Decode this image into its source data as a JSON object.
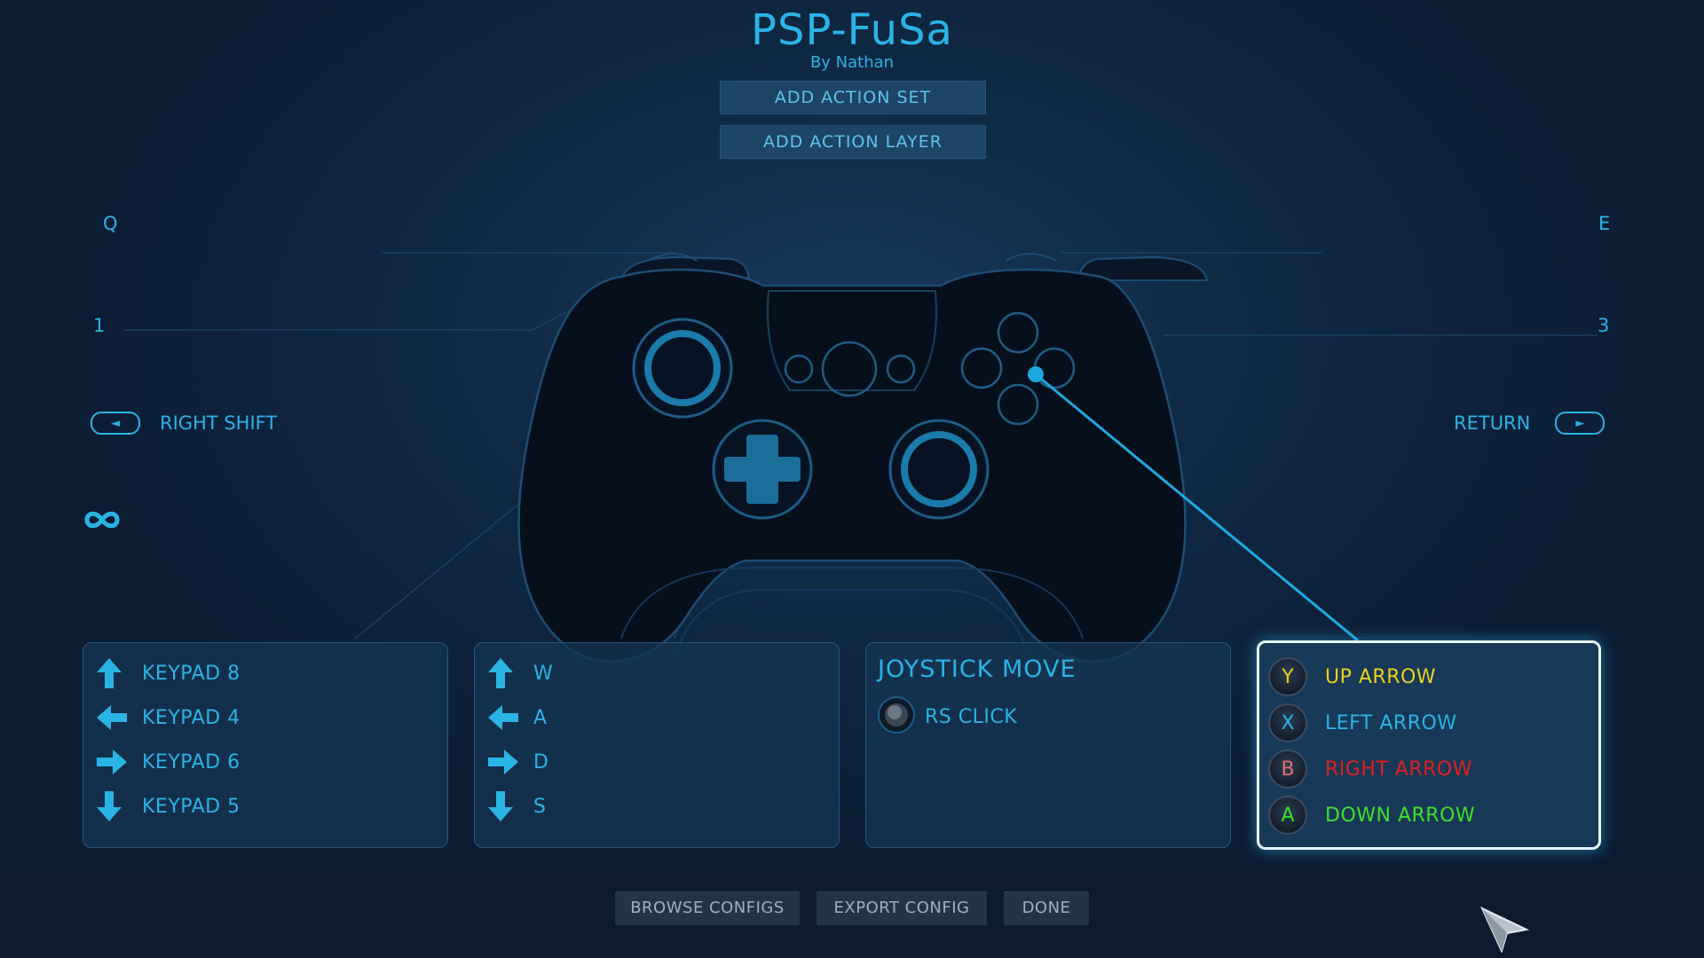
{
  "header": {
    "title": "PSP-FuSa",
    "author": "By Nathan",
    "add_action_set": "ADD ACTION SET",
    "add_action_layer": "ADD ACTION LAYER"
  },
  "left_bindings": {
    "top_left": "Q",
    "bumper_left": "1",
    "back_label": "RIGHT SHIFT",
    "back_pill_icon": "◄"
  },
  "right_bindings": {
    "top_right": "E",
    "bumper_right": "3",
    "start_label": "RETURN",
    "start_pill_icon": "►"
  },
  "panels": {
    "dpad": {
      "items": [
        {
          "icon": "arrow-up-icon",
          "label": "KEYPAD 8"
        },
        {
          "icon": "arrow-left-icon",
          "label": "KEYPAD 4"
        },
        {
          "icon": "arrow-right-icon",
          "label": "KEYPAD 6"
        },
        {
          "icon": "arrow-down-icon",
          "label": "KEYPAD 5"
        }
      ]
    },
    "left_stick": {
      "items": [
        {
          "icon": "arrow-up-icon",
          "label": "W"
        },
        {
          "icon": "arrow-left-icon",
          "label": "A"
        },
        {
          "icon": "arrow-right-icon",
          "label": "D"
        },
        {
          "icon": "arrow-down-icon",
          "label": "S"
        }
      ]
    },
    "right_stick": {
      "title": "JOYSTICK MOVE",
      "click_label": "RS CLICK"
    },
    "face_buttons": {
      "items": [
        {
          "letter": "Y",
          "label": "UP ARROW",
          "color": "#e8d21c"
        },
        {
          "letter": "X",
          "label": "LEFT ARROW",
          "color": "#2ab4e6"
        },
        {
          "letter": "B",
          "label": "RIGHT ARROW",
          "color": "#e0201e"
        },
        {
          "letter": "A",
          "label": "DOWN ARROW",
          "color": "#3ee02a"
        }
      ]
    }
  },
  "footer": {
    "browse": "BROWSE CONFIGS",
    "export": "EXPORT CONFIG",
    "done": "DONE"
  },
  "colors": {
    "accent": "#2ab4e6",
    "background": "#102a45"
  }
}
